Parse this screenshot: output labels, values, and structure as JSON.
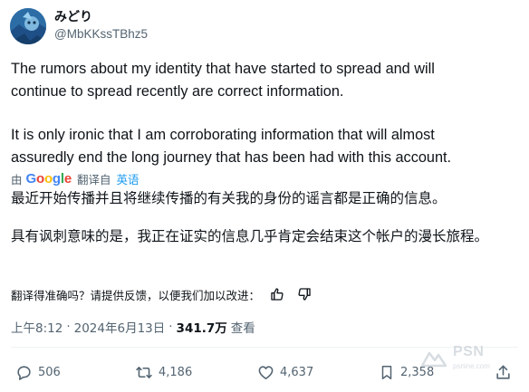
{
  "author": {
    "display_name": "みどり",
    "handle": "@MbKKssTBhz5"
  },
  "tweet": {
    "paragraph_1": "The rumors about my identity that have started to spread and will\ncontinue to spread recently are correct information.",
    "paragraph_2": "It is only ironic that I am corroborating information that will almost\nassuredly end the long journey that has been had with this account."
  },
  "translation": {
    "by_label": "由",
    "google_letters": [
      "G",
      "o",
      "o",
      "g",
      "l",
      "e"
    ],
    "translated_from_label": "翻译自",
    "source_language": "英语",
    "paragraph_1": "最近开始传播并且将继续传播的有关我的身份的谣言都是正确的信息。",
    "paragraph_2": "具有讽刺意味的是，我正在证实的信息几乎肯定会结束这个帐户的漫长旅程。"
  },
  "feedback": {
    "prompt": "翻译得准确吗？请提供反馈，以便我们加以改进："
  },
  "meta": {
    "time": "上午8:12",
    "separator": "·",
    "date": "2024年6月13日",
    "views_count": "341.7万",
    "views_label": "查看"
  },
  "actions": {
    "replies": "506",
    "retweets": "4,186",
    "likes": "4,637",
    "bookmarks": "2,358"
  },
  "watermark": {
    "text": "PSN",
    "subtext": "psnine.com"
  },
  "colors": {
    "text_primary": "#0f1419",
    "text_secondary": "#536471",
    "link_blue": "#1d9bf0",
    "google_blue": "#4285f4",
    "google_red": "#ea4335",
    "google_yellow": "#fbbc05",
    "google_green": "#34a853"
  },
  "icons": [
    "avatar",
    "thumbs-up-icon",
    "thumbs-down-icon",
    "reply-icon",
    "retweet-icon",
    "like-icon",
    "bookmark-icon",
    "share-icon"
  ]
}
